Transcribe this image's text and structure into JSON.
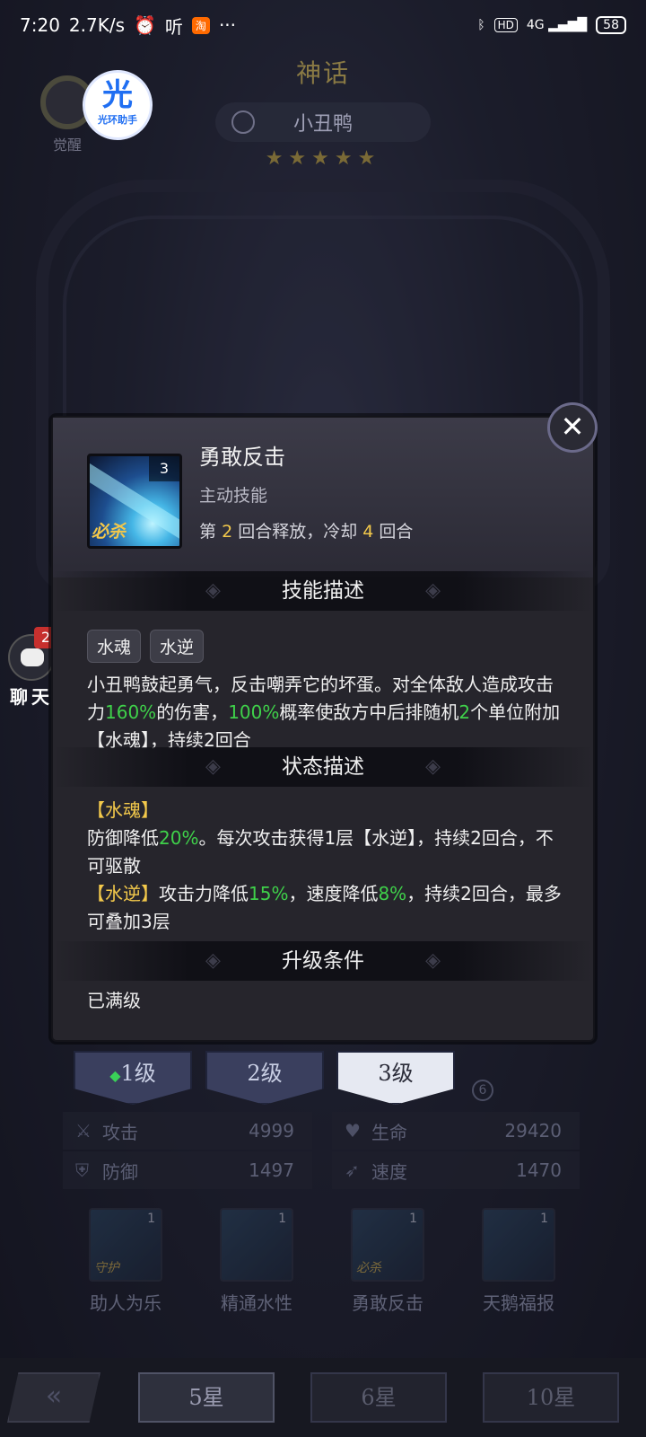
{
  "status_bar": {
    "time": "7:20",
    "speed": "2.7K/s",
    "ting": "听",
    "taobao": "淘",
    "more": "···",
    "hd": "HD",
    "network": "4G",
    "battery": "58"
  },
  "hero": {
    "rarity": "神话",
    "name": "小丑鸭",
    "stars": "★★★★★",
    "awaken_label": "觉醒"
  },
  "assistant": {
    "big": "光",
    "small": "光环助手"
  },
  "chat": {
    "badge": "2",
    "label": "聊天"
  },
  "skill": {
    "level": "3",
    "bisha": "必杀",
    "name": "勇敢反击",
    "type": "主动技能",
    "cd_prefix": "第",
    "cd_round": "2",
    "cd_mid": "回合释放，冷却",
    "cd_cool": "4",
    "cd_suffix": "回合"
  },
  "close_icon": "✕",
  "sections": {
    "desc_title": "技能描述",
    "status_title": "状态描述",
    "upgrade_title": "升级条件"
  },
  "tags": [
    "水魂",
    "水逆"
  ],
  "description": {
    "t1": "小丑鸭鼓起勇气，反击嘲弄它的坏蛋。对全体敌人造成攻击力",
    "v1": "160%",
    "t2": "的伤害，",
    "v2": "100%",
    "t3": "概率使敌方中后排随机",
    "v3": "2",
    "t4": "个单位附加【水魂】，持续2回合"
  },
  "status_desc": {
    "h1": "【水魂】",
    "a1": "防御降低",
    "av1": "20%",
    "a2": "。每次攻击获得1层【水逆】，持续2回合，不可驱散",
    "h2": "【水逆】",
    "b1": "攻击力降低",
    "bv1": "15%",
    "b2": "，速度降低",
    "bv2": "8%",
    "b3": "，持续2回合，最多可叠加3层"
  },
  "upgrade": "已满级",
  "levels": [
    {
      "label": "1级",
      "active": false
    },
    {
      "label": "2级",
      "active": false
    },
    {
      "label": "3级",
      "active": true
    }
  ],
  "level_extra": "6",
  "stats": {
    "attack_label": "攻击",
    "attack": "4999",
    "defense_label": "防御",
    "defense": "1497",
    "hp_label": "生命",
    "hp": "29420",
    "speed_label": "速度",
    "speed": "1470"
  },
  "skills": [
    {
      "name": "助人为乐",
      "level": "1",
      "tag": "守护"
    },
    {
      "name": "精通水性",
      "level": "1",
      "tag": ""
    },
    {
      "name": "勇敢反击",
      "level": "1",
      "tag": "必杀"
    },
    {
      "name": "天鹅福报",
      "level": "1",
      "tag": ""
    }
  ],
  "star_tabs": [
    "5星",
    "6星",
    "10星"
  ],
  "colors": {
    "highlight_green": "#3fd14a",
    "highlight_yellow": "#f3c94b",
    "badge_red": "#c7302e"
  }
}
